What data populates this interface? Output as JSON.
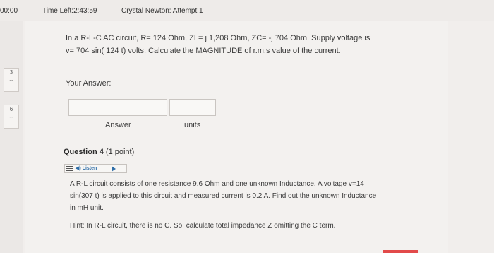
{
  "header": {
    "timer": "00:00",
    "time_left": "Time Left:2:43:59",
    "attempt_title": "Crystal Newton: Attempt 1"
  },
  "nav": {
    "q3_label": "3",
    "q3_dash": "--",
    "q6_label": "6",
    "q6_dash": "--"
  },
  "question3": {
    "text": "In a R-L-C AC circuit, R= 124 Ohm, ZL= j 1,208 Ohm, ZC= -j 704 Ohm. Supply voltage is v= 704 sin( 124 t) volts. Calculate the MAGNITUDE of r.m.s value of the current.",
    "your_answer_label": "Your Answer:",
    "answer_field_value": "",
    "units_field_value": "",
    "answer_label": "Answer",
    "units_label": "units"
  },
  "question4": {
    "title": "Question 4",
    "points": "(1 point)",
    "listen_label": "Listen",
    "text": "A R-L circuit consists of one resistance 9.6 Ohm and one unknown Inductance. A voltage v=14 sin(307 t) is applied to this circuit and measured current is 0.2 A. Find out the unknown Inductance in mH unit.",
    "hint": "Hint: In R-L circuit, there is no C. So, calculate total impedance Z omitting the C term."
  },
  "colors": {
    "accent_blue": "#2f6ea8",
    "red_marker": "#e24a4a"
  }
}
